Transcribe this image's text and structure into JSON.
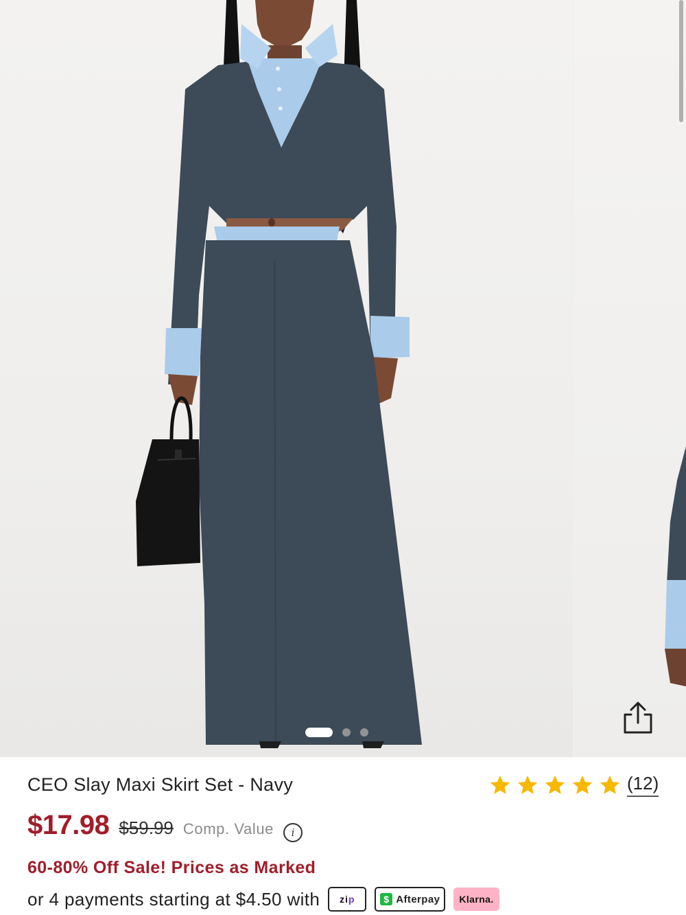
{
  "product": {
    "title": "CEO Slay Maxi Skirt Set - Navy",
    "rating": 5,
    "review_count": "(12)",
    "sale_price": "$17.98",
    "original_price": "$59.99",
    "comp_value_label": "Comp. Value",
    "promo": "60-80% Off Sale! Prices as Marked",
    "installment_text": "or 4 payments starting at $4.50 with"
  },
  "gallery": {
    "slide_count": 3,
    "active_slide": 1,
    "colors": {
      "background": "#f0efed",
      "suit_navy": "#3d4a57",
      "shirt_blue": "#aacbea",
      "bag_black": "#141414"
    }
  },
  "payment_providers": {
    "zip": {
      "label_a": "zi",
      "label_b": "p"
    },
    "afterpay": {
      "label": "Afterpay",
      "icon": "$"
    },
    "klarna": {
      "label": "Klarna."
    }
  },
  "colors": {
    "sale_red": "#a11d2a",
    "star_gold": "#f6b800",
    "muted_gray": "#8a8a8a"
  },
  "icons": {
    "share": "share-icon",
    "info": "info-icon",
    "star": "star-icon"
  }
}
